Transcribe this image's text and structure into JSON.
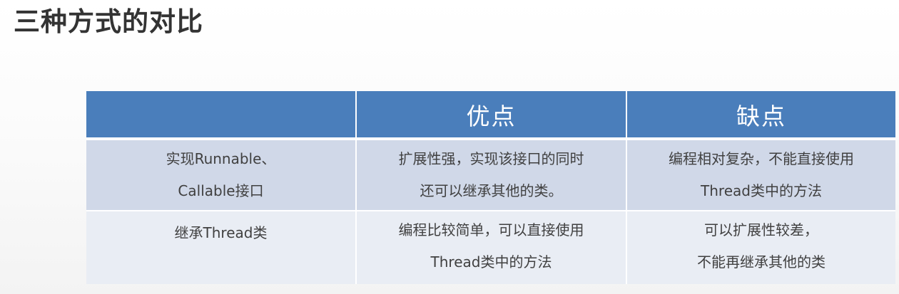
{
  "slide": {
    "title": "三种方式的对比"
  },
  "table": {
    "headers": [
      "",
      "优点",
      "缺点"
    ],
    "rows": [
      {
        "name": [
          "实现Runnable、",
          "Callable接口"
        ],
        "pros": [
          "扩展性强，实现该接口的同时",
          "还可以继承其他的类。"
        ],
        "cons": [
          "编程相对复杂，不能直接使用",
          "Thread类中的方法"
        ]
      },
      {
        "name": [
          "继承Thread类"
        ],
        "pros": [
          "编程比较简单，可以直接使用",
          "Thread类中的方法"
        ],
        "cons": [
          "可以扩展性较差，",
          "不能再继承其他的类"
        ]
      }
    ]
  },
  "colors": {
    "header_background": "#4a7ebb",
    "row_odd_background": "#d0d8e8",
    "row_even_background": "#e9edf4",
    "title_text": "#333333"
  }
}
